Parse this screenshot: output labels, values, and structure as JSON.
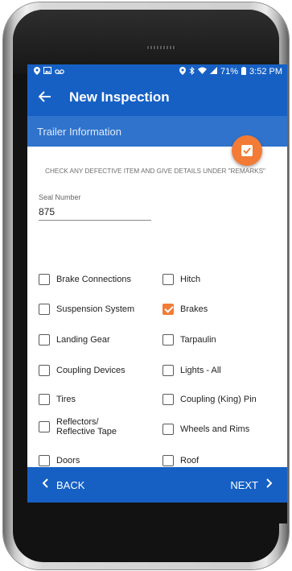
{
  "statusbar": {
    "left_icons": [
      "pin-icon",
      "image-icon",
      "voicemail-icon"
    ],
    "battery": "71%",
    "time": "3:52 PM"
  },
  "appbar": {
    "title": "New Inspection"
  },
  "section": {
    "title": "Trailer Information"
  },
  "instructions": "CHECK ANY DEFECTIVE ITEM AND GIVE DETAILS UNDER \"REMARKS\"",
  "seal": {
    "label": "Seal Number",
    "value": "875"
  },
  "items": [
    {
      "label": "Brake Connections",
      "checked": false
    },
    {
      "label": "Hitch",
      "checked": false
    },
    {
      "label": "Suspension System",
      "checked": false
    },
    {
      "label": "Brakes",
      "checked": true
    },
    {
      "label": "Landing Gear",
      "checked": false
    },
    {
      "label": "Tarpaulin",
      "checked": false
    },
    {
      "label": "Coupling Devices",
      "checked": false
    },
    {
      "label": "Lights - All",
      "checked": false
    },
    {
      "label": "Tires",
      "checked": false
    },
    {
      "label": "Coupling (King) Pin",
      "checked": false
    },
    {
      "label": "Reflectors/ Reflective Tape",
      "checked": false
    },
    {
      "label": "Wheels and Rims",
      "checked": false
    },
    {
      "label": "Doors",
      "checked": false
    },
    {
      "label": "Roof",
      "checked": false
    }
  ],
  "nav": {
    "back": "BACK",
    "next": "NEXT"
  },
  "colors": {
    "primary": "#1660c4",
    "section": "#3073cc",
    "accent": "#f27b35"
  }
}
